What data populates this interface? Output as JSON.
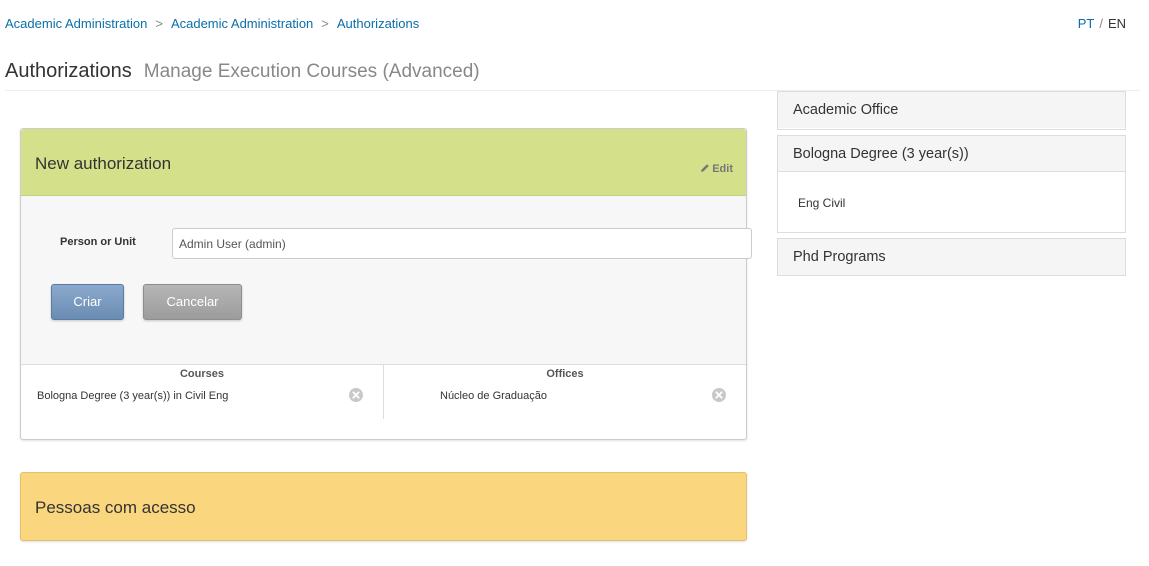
{
  "breadcrumb": {
    "item1": "Academic Administration",
    "item2": "Academic Administration",
    "item3": "Authorizations",
    "separator": ">"
  },
  "language": {
    "pt": "PT",
    "sep": "/",
    "en": "EN"
  },
  "header": {
    "title": "Authorizations",
    "subtitle": "Manage Execution Courses (Advanced)"
  },
  "new_authorization": {
    "title": "New authorization",
    "edit_label": "Edit",
    "person_label": "Person or Unit",
    "person_value": "Admin User (admin)",
    "create_button": "Criar",
    "cancel_button": "Cancelar",
    "courses_header": "Courses",
    "course_value": "Bologna Degree (3 year(s)) in Civil Eng",
    "offices_header": "Offices",
    "office_value": "Núcleo de Graduação"
  },
  "access": {
    "title": "Pessoas com acesso"
  },
  "sidebar": {
    "academic_office": "Academic Office",
    "bologna_degree": "Bologna Degree (3 year(s))",
    "bologna_item": "Eng Civil",
    "phd_programs": "Phd Programs"
  },
  "colors": {
    "green_header": "#d4e18a",
    "yellow_panel": "#fad67f",
    "link": "#0a6fa8",
    "primary_button": "#7a9cc0",
    "default_button": "#a8a8a8"
  }
}
